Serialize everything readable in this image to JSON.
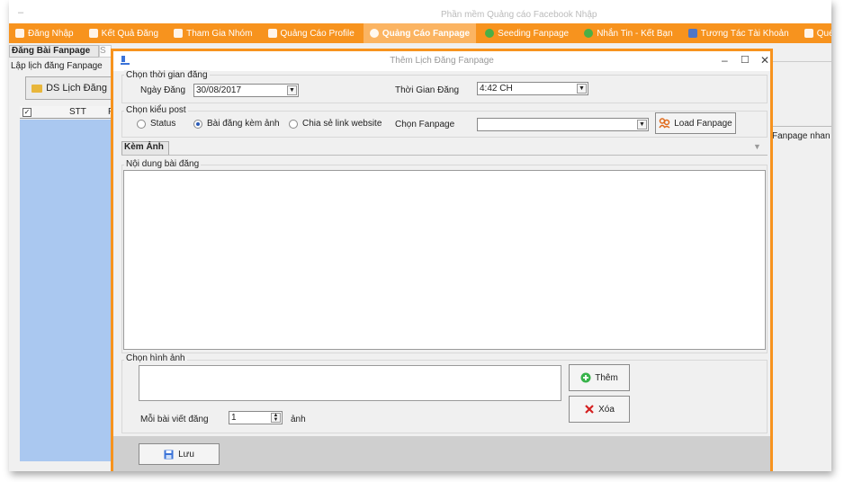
{
  "app": {
    "title": "Phần mềm Quảng cáo Facebook Nhập"
  },
  "menu": {
    "items": [
      {
        "label": "Đăng Nhập"
      },
      {
        "label": "Kết Quả Đăng"
      },
      {
        "label": "Tham Gia Nhóm"
      },
      {
        "label": "Quảng Cáo Profile"
      },
      {
        "label": "Quảng Cáo Fanpage"
      },
      {
        "label": "Seeding Fanpage"
      },
      {
        "label": "Nhắn Tin - Kết Bạn"
      },
      {
        "label": "Tương Tác Tài Khoản"
      },
      {
        "label": "Quét H"
      }
    ]
  },
  "background": {
    "tab_label": "Đăng Bài Fanpage",
    "tab2_label": "S",
    "section_label": "Lập lịch đăng Fanpage",
    "ds_button": "DS Lịch Đăng",
    "grid_headers": {
      "stt": "STT",
      "fanpage": "Fa"
    },
    "right_text": "Fanpage nhan"
  },
  "dialog": {
    "title": "Thêm Lịch Đăng Fanpage",
    "group_time": {
      "legend": "Chọn thời gian đăng",
      "date_label": "Ngày Đăng",
      "date_value": "30/08/2017",
      "time_label": "Thời Gian Đăng",
      "time_value": "4:42 CH"
    },
    "group_type": {
      "legend": "Chọn kiểu post",
      "options": [
        {
          "label": "Status",
          "checked": false
        },
        {
          "label": "Bài đăng kèm ảnh",
          "checked": true
        },
        {
          "label": "Chia sẻ link website",
          "checked": false
        }
      ],
      "fanpage_label": "Chọn Fanpage",
      "fanpage_value": "",
      "load_button": "Load Fanpage"
    },
    "tab_label": "Kèm Ảnh",
    "content_legend": "Nội dung bài đăng",
    "content_value": "",
    "image_group": {
      "legend": "Chọn hình ảnh",
      "add_button": "Thêm",
      "delete_button": "Xóa",
      "per_post_label": "Mỗi bài viết đăng",
      "per_post_value": "1",
      "unit": "ảnh"
    },
    "save_button": "Lưu"
  },
  "colors": {
    "accent": "#f7931e",
    "grid": "#aac8f0"
  }
}
